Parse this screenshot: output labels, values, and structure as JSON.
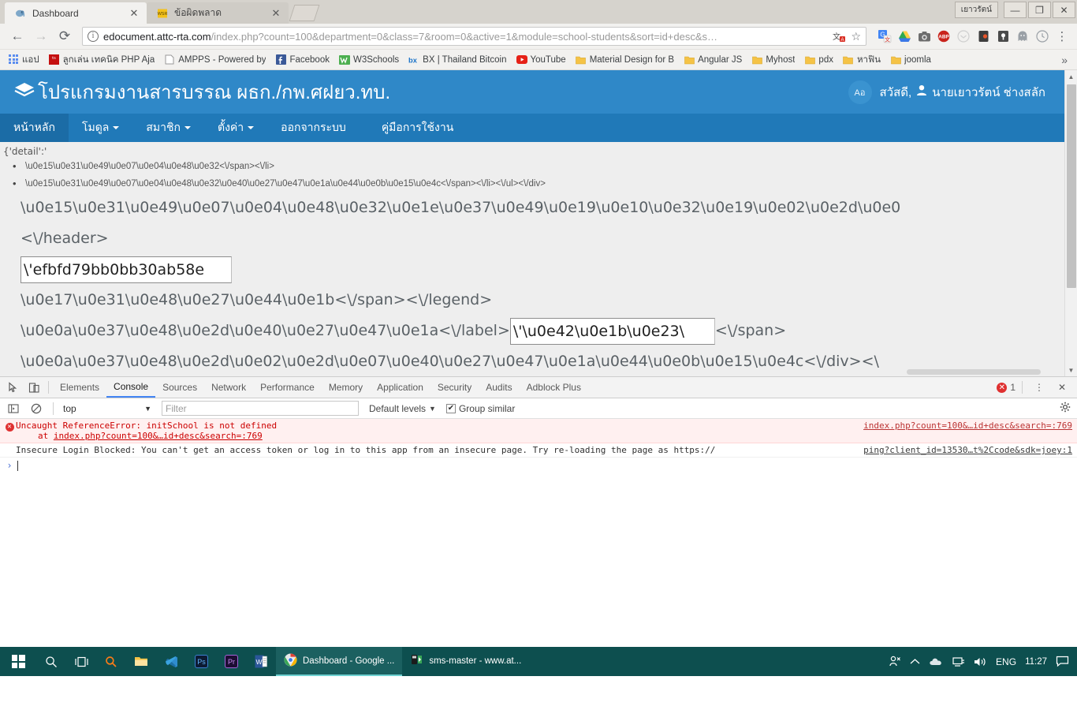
{
  "window": {
    "profile_button": "เยาวรัตน์",
    "minimize": "—",
    "maximize": "❐",
    "close": "✕"
  },
  "tabs": [
    {
      "title": "Dashboard",
      "favicon": "elephant-favicon",
      "active": true,
      "close": "✕"
    },
    {
      "title": "ข้อผิดพลาด",
      "favicon": "wsr-favicon",
      "active": false,
      "close": "✕"
    }
  ],
  "toolbar": {
    "back": "←",
    "forward": "→",
    "reload": "⟳",
    "info_icon": "i",
    "url_domain": "edocument.attc-rta.com",
    "url_path": "/index.php?count=100&department=0&class=7&room=0&active=1&module=school-students&sort=id+desc&s…",
    "translate_icon": "translate-icon",
    "star_icon": "☆",
    "extensions": [
      "google-translate-ext",
      "google-drive-ext",
      "screenshot-ext",
      "adblock-plus-ext",
      "pocket-ext",
      "lastpass-ext",
      "dashlane-ext",
      "ghostery-ext",
      "clock-ext"
    ],
    "menu_icon": "⋮"
  },
  "bookmarks": {
    "apps_label": "แอป",
    "items": [
      {
        "label": "ลูกเล่น เทคนิค PHP Aja",
        "icon": "news-favicon"
      },
      {
        "label": "AMPPS - Powered by",
        "icon": "page-favicon"
      },
      {
        "label": "Facebook",
        "icon": "facebook-favicon"
      },
      {
        "label": "W3Schools",
        "icon": "w3schools-favicon"
      },
      {
        "label": "BX | Thailand Bitcoin",
        "icon": "bx-favicon"
      },
      {
        "label": "YouTube",
        "icon": "youtube-favicon"
      },
      {
        "label": "Material Design for B",
        "icon": "folder-favicon"
      },
      {
        "label": "Angular JS",
        "icon": "folder-favicon"
      },
      {
        "label": "Myhost",
        "icon": "folder-favicon"
      },
      {
        "label": "pdx",
        "icon": "folder-favicon"
      },
      {
        "label": "หาฟิน",
        "icon": "folder-favicon"
      },
      {
        "label": "joomla",
        "icon": "folder-favicon"
      }
    ],
    "overflow": "»"
  },
  "app": {
    "logo_icon": "layers-icon",
    "title": "โปรแกรมงานสารบรรณ ผธก./กพ.ศฝยว.ทบ.",
    "lang_toggle": "Aอ",
    "greeting_prefix": "สวัสดี,",
    "user_icon": "person-icon",
    "user_name": "นายเยาวรัตน์ ช่างสลัก",
    "nav": [
      {
        "label": "หน้าหลัก",
        "active": true,
        "dropdown": false
      },
      {
        "label": "โมดูล",
        "active": false,
        "dropdown": true
      },
      {
        "label": "สมาชิก",
        "active": false,
        "dropdown": true
      },
      {
        "label": "ตั้งค่า",
        "active": false,
        "dropdown": true
      },
      {
        "label": "ออกจากระบบ",
        "active": false,
        "dropdown": false
      },
      {
        "label": "คู่มือการใช้งาน",
        "active": false,
        "dropdown": false
      }
    ]
  },
  "content": {
    "detail_line": "{'detail':'",
    "bullets": [
      "\\u0e15\\u0e31\\u0e49\\u0e07\\u0e04\\u0e48\\u0e32<\\/span><\\/li>",
      "\\u0e15\\u0e31\\u0e49\\u0e07\\u0e04\\u0e48\\u0e32\\u0e40\\u0e27\\u0e47\\u0e1a\\u0e44\\u0e0b\\u0e15\\u0e4c<\\/span><\\/li><\\/ul><\\/div>"
    ],
    "line_big_1": "\\u0e15\\u0e31\\u0e49\\u0e07\\u0e04\\u0e48\\u0e32\\u0e1e\\u0e37\\u0e49\\u0e19\\u0e10\\u0e32\\u0e19\\u0e02\\u0e2d\\u0e0",
    "line_header_close": "<\\/header>",
    "input_1_value": "\\'efbfd79bb0bb30ab58e",
    "line_big_2": "\\u0e17\\u0e31\\u0e48\\u0e27\\u0e44\\u0e1b<\\/span><\\/legend>",
    "line_big_3_pre": "\\u0e0a\\u0e37\\u0e48\\u0e2d\\u0e40\\u0e27\\u0e47\\u0e1a<\\/label>",
    "input_2_value": "\\'\\u0e42\\u0e1b\\u0e23\\",
    "line_big_3_post": "<\\/span>",
    "line_big_4": "\\u0e0a\\u0e37\\u0e48\\u0e2d\\u0e02\\u0e2d\\u0e07\\u0e40\\u0e27\\u0e47\\u0e1a\\u0e44\\u0e0b\\u0e15\\u0e4c<\\/div><\\"
  },
  "devtools": {
    "inspect_icon": "inspect-icon",
    "device_icon": "device-toolbar-icon",
    "tabs": [
      {
        "label": "Elements",
        "active": false
      },
      {
        "label": "Console",
        "active": true
      },
      {
        "label": "Sources",
        "active": false
      },
      {
        "label": "Network",
        "active": false
      },
      {
        "label": "Performance",
        "active": false
      },
      {
        "label": "Memory",
        "active": false
      },
      {
        "label": "Application",
        "active": false
      },
      {
        "label": "Security",
        "active": false
      },
      {
        "label": "Audits",
        "active": false
      },
      {
        "label": "Adblock Plus",
        "active": false
      }
    ],
    "error_count": "1",
    "more_icon": "⋮",
    "close_icon": "✕",
    "sidebar_toggle_icon": "console-sidebar-icon",
    "clear_icon": "🚫",
    "context_value": "top",
    "context_caret": "▼",
    "filter_placeholder": "Filter",
    "levels_label": "Default levels",
    "levels_caret": "▼",
    "group_similar_label": "Group similar",
    "group_similar_checked": "✔",
    "settings_icon": "gear-icon",
    "messages": [
      {
        "level": "error",
        "icon": "error-icon",
        "line1": "Uncaught ReferenceError: initSchool is not defined",
        "line2_prefix": "at ",
        "line2_link": "index.php?count=100&…id+desc&search=:769",
        "source": "index.php?count=100&…id+desc&search=:769"
      },
      {
        "level": "info",
        "icon": "",
        "line1": "Insecure Login Blocked: You can't get an access token or log in to this app from an insecure page. Try re-loading the page as https://",
        "line2_prefix": "",
        "line2_link": "",
        "source": "ping?client_id=13530…t%2Ccode&sdk=joey:1"
      }
    ],
    "prompt_arrow": "›"
  },
  "taskbar": {
    "start_icon": "windows-logo",
    "search_icon": "search-icon",
    "taskview_icon": "task-view-icon",
    "pinned": [
      {
        "icon": "cortana-search-icon",
        "name": "cortana"
      },
      {
        "icon": "file-explorer-icon",
        "name": "file-explorer"
      },
      {
        "icon": "vscode-icon",
        "name": "visual-studio-code"
      },
      {
        "icon": "photoshop-icon",
        "name": "photoshop",
        "label": "Ps"
      },
      {
        "icon": "premiere-icon",
        "name": "premiere-pro",
        "label": "Pr"
      },
      {
        "icon": "word-icon",
        "name": "microsoft-word",
        "label": "W"
      }
    ],
    "apps": [
      {
        "label": "Dashboard - Google ...",
        "icon": "chrome-icon",
        "active": true
      },
      {
        "label": "sms-master - www.at...",
        "icon": "filezilla-icon",
        "active": false
      }
    ],
    "tray": {
      "people_icon": "people-icon",
      "chevron_icon": "︿",
      "onedrive_icon": "cloud-icon",
      "network_icon": "network-icon",
      "volume_icon": "volume-icon",
      "language": "ENG",
      "clock": "11:27",
      "notification_icon": "notification-icon"
    }
  },
  "colors": {
    "app_header": "#2f88c8",
    "app_nav": "#2079b8",
    "accent": "#4285f4",
    "error": "#df3030",
    "taskbar": "#0d4f4f"
  }
}
